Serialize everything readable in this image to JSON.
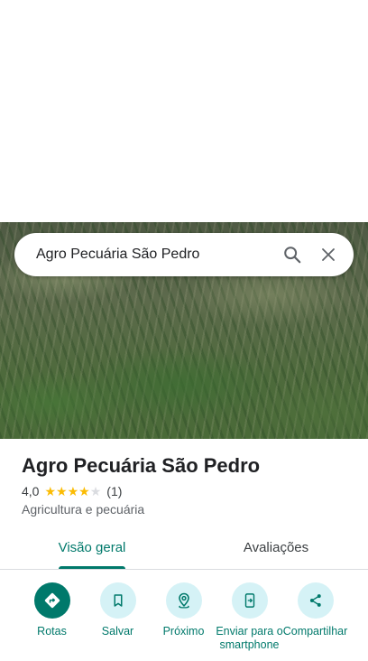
{
  "search": {
    "query": "Agro Pecuária São Pedro"
  },
  "place": {
    "name": "Agro Pecuária São Pedro",
    "rating": "4,0",
    "stars": 4,
    "review_count": "(1)",
    "category": "Agricultura e pecuária"
  },
  "tabs": [
    {
      "label": "Visão geral",
      "active": true
    },
    {
      "label": "Avaliações",
      "active": false
    }
  ],
  "actions": [
    {
      "label": "Rotas",
      "icon": "directions-icon"
    },
    {
      "label": "Salvar",
      "icon": "bookmark-icon"
    },
    {
      "label": "Próximo",
      "icon": "nearby-icon"
    },
    {
      "label": "Enviar para o smartphone",
      "icon": "send-to-phone-icon"
    },
    {
      "label": "Compartilhar",
      "icon": "share-icon"
    }
  ],
  "colors": {
    "accent": "#00796b",
    "action_bg": "#d5f2f6",
    "star": "#fbbc04",
    "star_empty": "#dadce0"
  }
}
